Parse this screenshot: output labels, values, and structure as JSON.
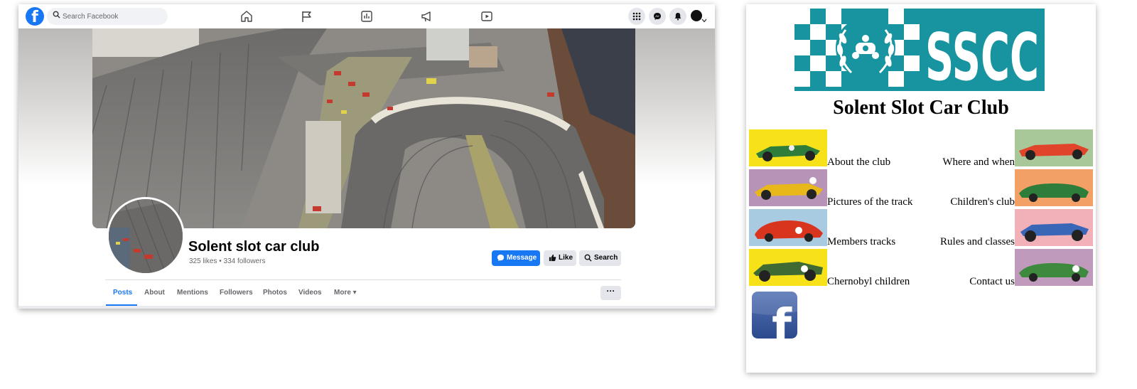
{
  "facebook": {
    "search_placeholder": "Search Facebook",
    "logo_letter": "f",
    "nav_icons": [
      "home-icon",
      "flag-icon",
      "ads-manager-icon",
      "megaphone-icon",
      "video-icon"
    ],
    "right_icons": [
      "menu-grid-icon",
      "messenger-icon",
      "bell-icon",
      "account-icon"
    ],
    "page_name": "Solent slot car club",
    "stats": "325 likes • 334 followers",
    "buttons": {
      "message": "Message",
      "like": "Like",
      "search": "Search"
    },
    "tabs": [
      {
        "label": "Posts",
        "active": true
      },
      {
        "label": "About"
      },
      {
        "label": "Mentions"
      },
      {
        "label": "Followers"
      },
      {
        "label": "Photos"
      },
      {
        "label": "Videos"
      },
      {
        "label": "More ▾"
      }
    ],
    "more_options": "···",
    "colors": {
      "brand": "#1877f2",
      "button_grey": "#e4e6eb",
      "text": "#050505",
      "muted": "#65676b"
    }
  },
  "site": {
    "banner_text": "SSCC",
    "title": "Solent Slot Car Club",
    "links_left": [
      "About the club",
      "Pictures of the track",
      "Members tracks",
      "Chernobyl children"
    ],
    "links_right": [
      "Where and when",
      "Children's club",
      "Rules and classes",
      "Contact us"
    ],
    "facebook_logo": "f",
    "colors": {
      "banner_teal": "#17949f"
    }
  }
}
